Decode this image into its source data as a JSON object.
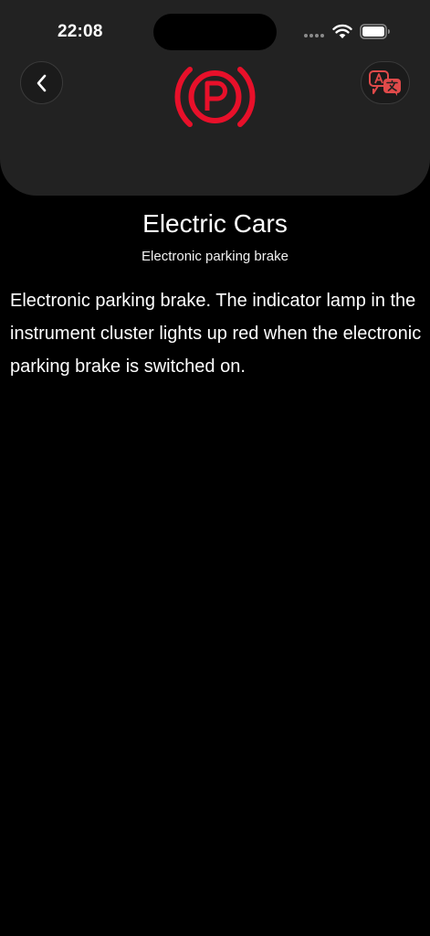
{
  "status_bar": {
    "time": "22:08"
  },
  "header": {
    "back_icon": "chevron-left-icon",
    "indicator_icon": "parking-brake-icon",
    "translate_icon": "translate-icon",
    "indicator_color": "#e8102a",
    "translate_icon_color": "#e04a4a"
  },
  "content": {
    "title": "Electric Cars",
    "subtitle": "Electronic parking brake",
    "description": "Electronic parking brake.  The indicator lamp in the instrument cluster lights up red when the electronic parking brake is switched on."
  },
  "colors": {
    "background": "#000000",
    "header_background": "#222222",
    "text": "#ffffff"
  }
}
